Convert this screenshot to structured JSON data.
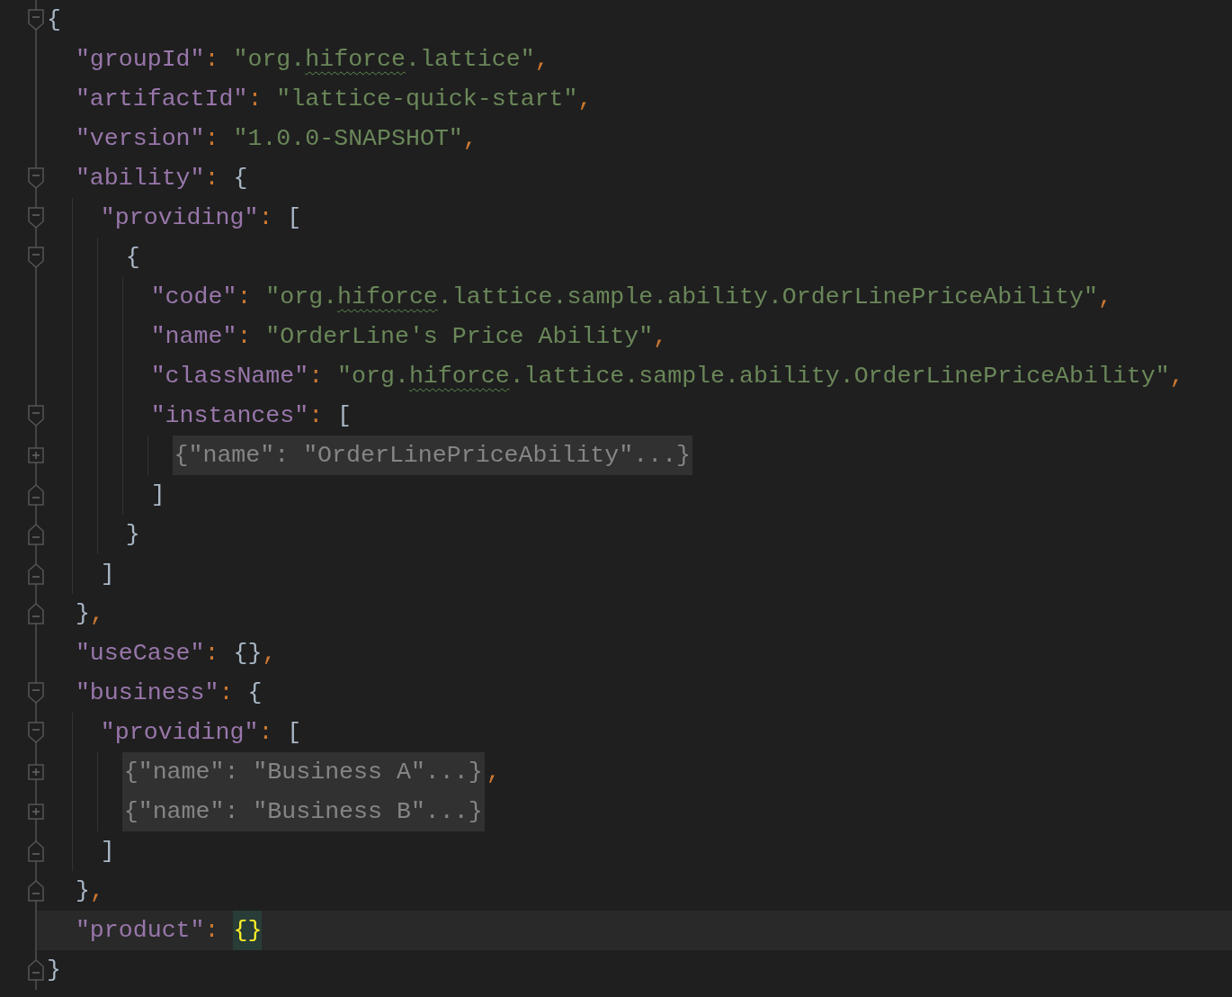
{
  "editor": {
    "lines": [
      {
        "kind": "fold-start",
        "current": false,
        "tokens": [
          {
            "kind": "punct",
            "text": "{"
          }
        ]
      },
      {
        "kind": "plain",
        "current": false,
        "tokens": [
          {
            "kind": "key",
            "text": "  \"groupId\""
          },
          {
            "kind": "sep",
            "text": ": "
          },
          {
            "kind": "string",
            "text": "\"org."
          },
          {
            "kind": "typo-string",
            "text": "hiforce"
          },
          {
            "kind": "string",
            "text": ".lattice\""
          },
          {
            "kind": "sep",
            "text": ","
          }
        ]
      },
      {
        "kind": "plain",
        "current": false,
        "tokens": [
          {
            "kind": "key",
            "text": "  \"artifactId\""
          },
          {
            "kind": "sep",
            "text": ": "
          },
          {
            "kind": "string",
            "text": "\"lattice-quick-start\""
          },
          {
            "kind": "sep",
            "text": ","
          }
        ]
      },
      {
        "kind": "plain",
        "current": false,
        "tokens": [
          {
            "kind": "key",
            "text": "  \"version\""
          },
          {
            "kind": "sep",
            "text": ": "
          },
          {
            "kind": "string",
            "text": "\"1.0.0-SNAPSHOT\""
          },
          {
            "kind": "sep",
            "text": ","
          }
        ]
      },
      {
        "kind": "fold-start",
        "current": false,
        "tokens": [
          {
            "kind": "key",
            "text": "  \"ability\""
          },
          {
            "kind": "sep",
            "text": ": "
          },
          {
            "kind": "punct",
            "text": "{"
          }
        ]
      },
      {
        "kind": "fold-start",
        "current": false,
        "tokens": [
          {
            "kind": "key",
            "text": "    \"providing\""
          },
          {
            "kind": "sep",
            "text": ": "
          },
          {
            "kind": "punct",
            "text": "["
          }
        ]
      },
      {
        "kind": "fold-start",
        "current": false,
        "tokens": [
          {
            "kind": "punct",
            "text": "      {"
          }
        ]
      },
      {
        "kind": "plain",
        "current": false,
        "tokens": [
          {
            "kind": "key",
            "text": "        \"code\""
          },
          {
            "kind": "sep",
            "text": ": "
          },
          {
            "kind": "string",
            "text": "\"org."
          },
          {
            "kind": "typo-string",
            "text": "hiforce"
          },
          {
            "kind": "string",
            "text": ".lattice.sample.ability.OrderLinePriceAbility\""
          },
          {
            "kind": "sep",
            "text": ","
          }
        ]
      },
      {
        "kind": "plain",
        "current": false,
        "tokens": [
          {
            "kind": "key",
            "text": "        \"name\""
          },
          {
            "kind": "sep",
            "text": ": "
          },
          {
            "kind": "string",
            "text": "\"OrderLine's Price Ability\""
          },
          {
            "kind": "sep",
            "text": ","
          }
        ]
      },
      {
        "kind": "plain",
        "current": false,
        "tokens": [
          {
            "kind": "key",
            "text": "        \"className\""
          },
          {
            "kind": "sep",
            "text": ": "
          },
          {
            "kind": "string",
            "text": "\"org."
          },
          {
            "kind": "typo-string",
            "text": "hiforce"
          },
          {
            "kind": "string",
            "text": ".lattice.sample.ability.OrderLinePriceAbility\""
          },
          {
            "kind": "sep",
            "text": ","
          }
        ]
      },
      {
        "kind": "fold-start",
        "current": false,
        "tokens": [
          {
            "kind": "key",
            "text": "        \"instances\""
          },
          {
            "kind": "sep",
            "text": ": "
          },
          {
            "kind": "punct",
            "text": "["
          }
        ]
      },
      {
        "kind": "folded",
        "current": false,
        "tokens": [
          {
            "kind": "folded",
            "text": "          {\"name\": \"OrderLinePriceAbility\"...}"
          }
        ]
      },
      {
        "kind": "fold-end",
        "current": false,
        "tokens": [
          {
            "kind": "punct",
            "text": "        ]"
          }
        ]
      },
      {
        "kind": "fold-end",
        "current": false,
        "tokens": [
          {
            "kind": "punct",
            "text": "      }"
          }
        ]
      },
      {
        "kind": "fold-end",
        "current": false,
        "tokens": [
          {
            "kind": "punct",
            "text": "    ]"
          }
        ]
      },
      {
        "kind": "fold-end",
        "current": false,
        "tokens": [
          {
            "kind": "punct",
            "text": "  }"
          },
          {
            "kind": "sep",
            "text": ","
          }
        ]
      },
      {
        "kind": "plain",
        "current": false,
        "tokens": [
          {
            "kind": "key",
            "text": "  \"useCase\""
          },
          {
            "kind": "sep",
            "text": ": "
          },
          {
            "kind": "punct",
            "text": "{}"
          },
          {
            "kind": "sep",
            "text": ","
          }
        ]
      },
      {
        "kind": "fold-start",
        "current": false,
        "tokens": [
          {
            "kind": "key",
            "text": "  \"business\""
          },
          {
            "kind": "sep",
            "text": ": "
          },
          {
            "kind": "punct",
            "text": "{"
          }
        ]
      },
      {
        "kind": "fold-start",
        "current": false,
        "tokens": [
          {
            "kind": "key",
            "text": "    \"providing\""
          },
          {
            "kind": "sep",
            "text": ": "
          },
          {
            "kind": "punct",
            "text": "["
          }
        ]
      },
      {
        "kind": "folded",
        "current": false,
        "tokens": [
          {
            "kind": "folded",
            "text": "      {\"name\": \"Business A\"...}"
          },
          {
            "kind": "sep",
            "text": ","
          }
        ]
      },
      {
        "kind": "folded",
        "current": false,
        "tokens": [
          {
            "kind": "folded",
            "text": "      {\"name\": \"Business B\"...}"
          }
        ]
      },
      {
        "kind": "fold-end",
        "current": false,
        "tokens": [
          {
            "kind": "punct",
            "text": "    ]"
          }
        ]
      },
      {
        "kind": "fold-end",
        "current": false,
        "tokens": [
          {
            "kind": "punct",
            "text": "  }"
          },
          {
            "kind": "sep",
            "text": ","
          }
        ]
      },
      {
        "kind": "plain",
        "current": true,
        "tokens": [
          {
            "kind": "key",
            "text": "  \"product\""
          },
          {
            "kind": "sep",
            "text": ": "
          },
          {
            "kind": "brace-match",
            "text": "{}"
          }
        ]
      },
      {
        "kind": "fold-end",
        "current": false,
        "tokens": [
          {
            "kind": "punct",
            "text": "}"
          }
        ]
      }
    ]
  }
}
